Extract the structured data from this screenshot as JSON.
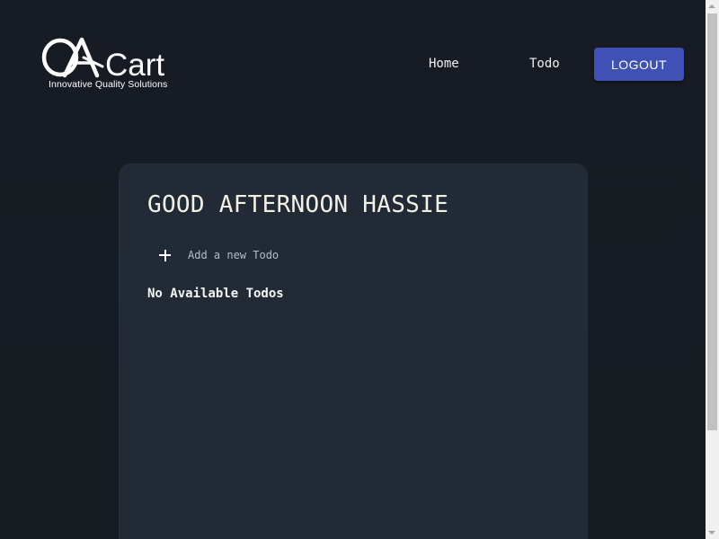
{
  "header": {
    "logo": {
      "text": "QACart",
      "tagline": "Innovative Quality Solutions"
    },
    "nav": {
      "home_label": "Home",
      "todo_label": "Todo",
      "logout_label": "LOGOUT"
    }
  },
  "main": {
    "greeting": "GOOD AFTERNOON HASSIE",
    "add_todo_placeholder": "Add a new Todo",
    "empty_message": "No Available Todos"
  },
  "colors": {
    "background": "#171c24",
    "card": "#212a35",
    "accent": "#3f51b5"
  },
  "icons": {
    "add": "plus-icon",
    "logo": "qacart-logo-icon"
  }
}
